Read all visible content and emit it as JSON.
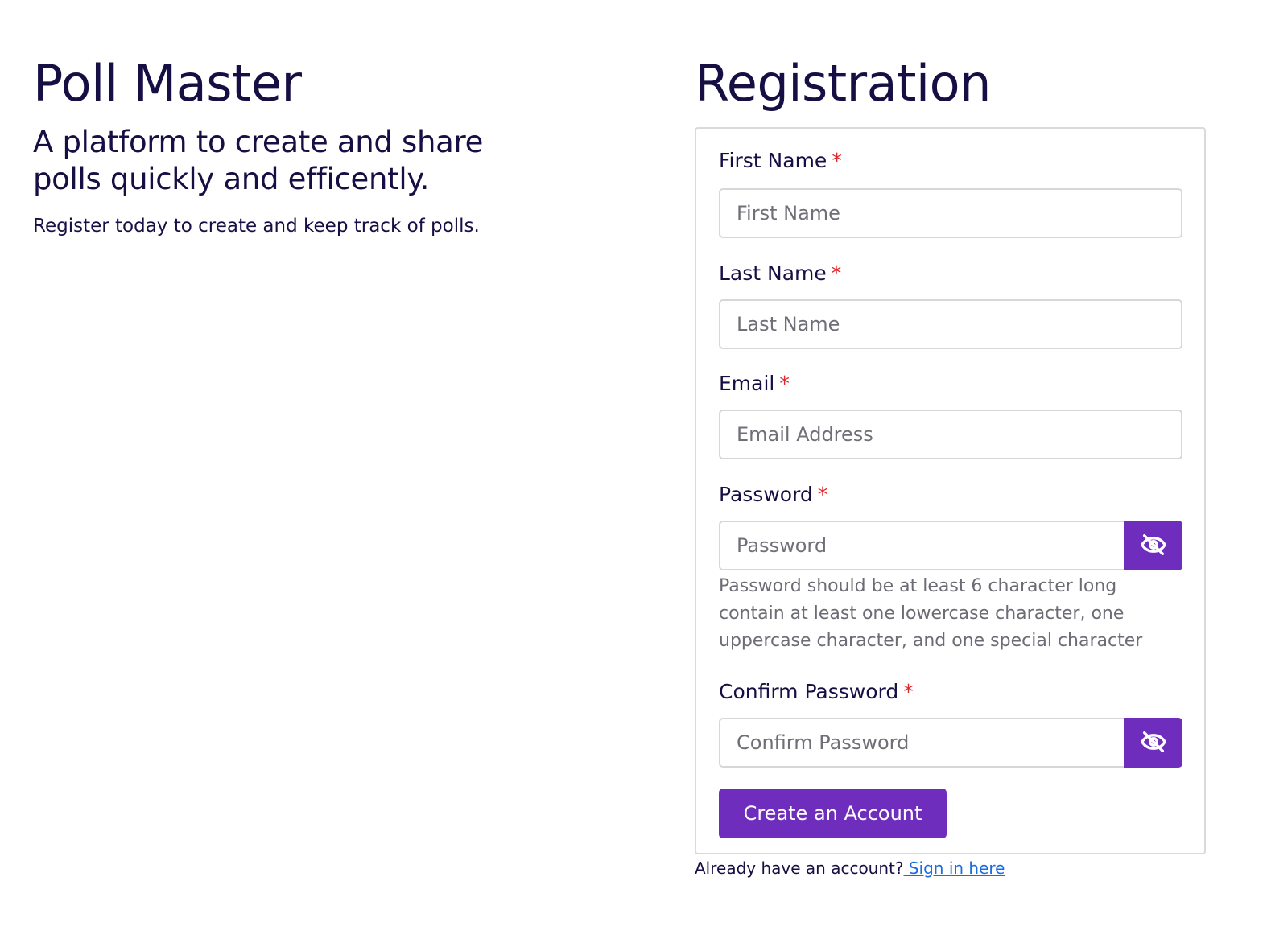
{
  "intro": {
    "app_title": "Poll Master",
    "tagline": "A platform to create and share polls quickly and efficently.",
    "subtext": "Register today to create and keep track of polls."
  },
  "registration": {
    "title": "Registration",
    "required_marker": "*",
    "fields": {
      "first_name": {
        "label": "First Name",
        "placeholder": "First Name"
      },
      "last_name": {
        "label": "Last Name",
        "placeholder": "Last Name"
      },
      "email": {
        "label": "Email",
        "placeholder": "Email Address"
      },
      "password": {
        "label": "Password",
        "placeholder": "Password",
        "help": "Password should be at least 6 character long contain at least one lowercase character, one uppercase character, and one special character"
      },
      "confirm_password": {
        "label": "Confirm Password",
        "placeholder": "Confirm Password"
      }
    },
    "submit_label": "Create an Account",
    "signin_prompt": "Already have an account?",
    "signin_link": " Sign in here"
  },
  "icons": {
    "toggle_visibility": "eye-slash-icon"
  },
  "colors": {
    "primary": "#6f2dbd",
    "text": "#160f44",
    "required": "#e0272d",
    "link": "#1a6de0",
    "muted": "#6c6c75"
  }
}
